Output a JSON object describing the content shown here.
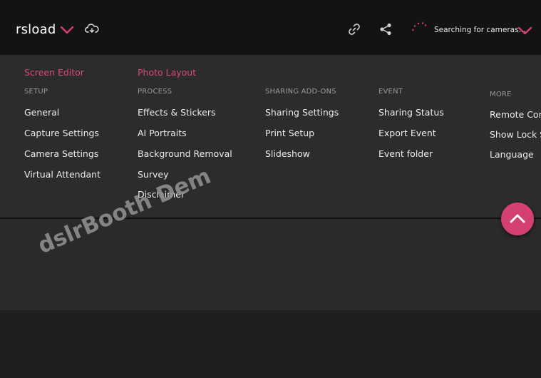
{
  "header": {
    "brand": "rsload",
    "status_text": "Searching for cameras..."
  },
  "tabs": {
    "screen_editor": "Screen Editor",
    "photo_layout": "Photo Layout"
  },
  "columns": {
    "setup": {
      "heading": "SETUP",
      "items": [
        "General",
        "Capture Settings",
        "Camera Settings",
        "Virtual Attendant"
      ]
    },
    "process": {
      "heading": "PROCESS",
      "items": [
        "Effects & Stickers",
        "AI Portraits",
        "Background Removal",
        "Survey",
        "Disclaimer"
      ]
    },
    "sharing_addons": {
      "heading": "SHARING ADD-ONS",
      "items": [
        "Sharing Settings",
        "Print Setup",
        "Slideshow"
      ]
    },
    "event": {
      "heading": "EVENT",
      "items": [
        "Sharing Status",
        "Export Event",
        "Event folder"
      ]
    },
    "more": {
      "heading": "MORE",
      "items": [
        "Remote Cont",
        "Show Lock Sc",
        "Language"
      ]
    }
  },
  "watermark": "dslrBooth Dem",
  "colors": {
    "accent": "#d4406f",
    "topbar": "#131313",
    "panel": "#2c2c2c"
  }
}
